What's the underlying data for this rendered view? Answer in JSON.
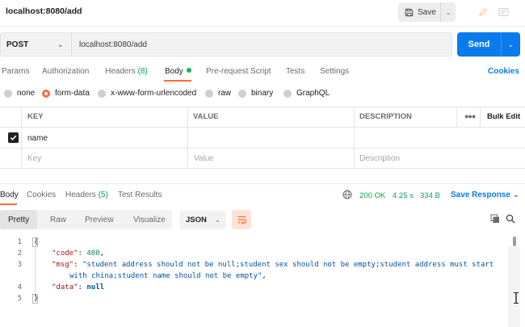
{
  "window": {
    "title": "localhost:8080/add",
    "save_label": "Save"
  },
  "request": {
    "method": "POST",
    "url": "localhost:8080/add",
    "send_label": "Send",
    "tabs": [
      {
        "label": "Params"
      },
      {
        "label": "Authorization"
      },
      {
        "label": "Headers",
        "count": "(8)"
      },
      {
        "label": "Body"
      },
      {
        "label": "Pre-request Script"
      },
      {
        "label": "Tests"
      },
      {
        "label": "Settings"
      }
    ],
    "cookies_label": "Cookies",
    "body_types": [
      "none",
      "form-data",
      "x-www-form-urlencoded",
      "raw",
      "binary",
      "GraphQL"
    ],
    "body_type_selected": "form-data",
    "table": {
      "headers": [
        "KEY",
        "VALUE",
        "DESCRIPTION"
      ],
      "bulk_edit": "Bulk Edit",
      "rows": [
        {
          "checked": true,
          "key": "name",
          "value": "",
          "description": ""
        }
      ],
      "placeholders": {
        "key": "Key",
        "value": "Value",
        "description": "Description"
      }
    }
  },
  "response": {
    "tabs": [
      {
        "label": "Body"
      },
      {
        "label": "Cookies"
      },
      {
        "label": "Headers",
        "count": "(5)"
      },
      {
        "label": "Test Results"
      }
    ],
    "status": "200 OK",
    "time": "4.25 s",
    "size": "334 B",
    "save_response_label": "Save Response",
    "view_tabs": [
      "Pretty",
      "Raw",
      "Preview",
      "Visualize"
    ],
    "format": "JSON",
    "line_numbers": [
      "1",
      "2",
      "3",
      "4",
      "5"
    ],
    "code": {
      "open_brace": "{",
      "code_key": "\"code\"",
      "code_value": "400",
      "msg_key": "\"msg\"",
      "msg_value_line1": "\"student address should not be null;student sex should not be empty;student address must start",
      "msg_value_line2": "with china;student name should not be empty\"",
      "data_key": "\"data\"",
      "data_value": "null",
      "close_brace": "}"
    }
  },
  "colors": {
    "accent": "#ff6c37",
    "send_button": "#097bed",
    "status_ok": "#0ca152"
  },
  "icons": [
    "save-icon",
    "chevron-down-icon",
    "edit-icon",
    "document-icon",
    "globe-icon",
    "wrap-lines-icon",
    "copy-icon",
    "search-icon",
    "more-icon"
  ]
}
